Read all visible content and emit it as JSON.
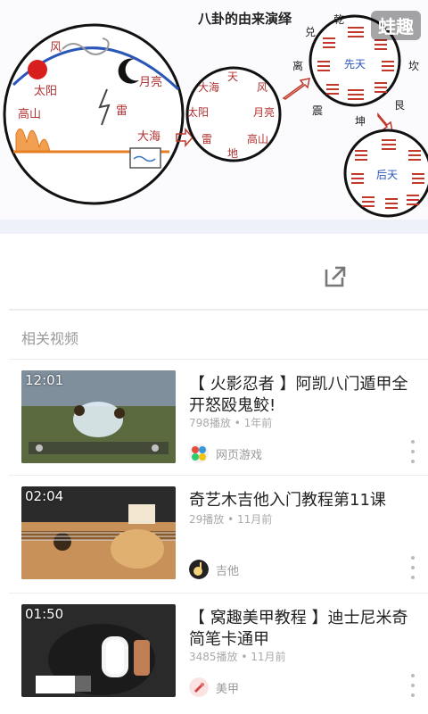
{
  "player": {
    "diagram_title": "八卦的由来演绎",
    "watermark": "蛙趣",
    "left_circle_labels": {
      "feng": "风",
      "taiyang": "太阳",
      "yueliang": "月亮",
      "lei": "雷",
      "gaoshan": "高山",
      "dahai": "大海"
    },
    "middle_circle_labels": {
      "tian": "天",
      "dahai": "大海",
      "feng": "风",
      "taiyang": "太阳",
      "yueliang": "月亮",
      "lei": "雷",
      "gaoshan": "高山",
      "di": "地"
    },
    "right_top_labels": {
      "dui": "兑",
      "qian": "乾",
      "li": "离",
      "xiantian": "先天",
      "kan": "坎",
      "zhen": "震",
      "kun": "坤",
      "gen": "艮"
    },
    "right_bottom_label": "后天"
  },
  "related": {
    "title": "相关视频",
    "items": [
      {
        "duration": "12:01",
        "title": "【 火影忍者 】阿凯八门遁甲全开怒殴鬼鲛!",
        "plays": "798播放",
        "time": "1年前",
        "category": "网页游戏",
        "theme": "game"
      },
      {
        "duration": "02:04",
        "title": "奇艺木吉他入门教程第11课",
        "plays": "29播放",
        "time": "11月前",
        "category": "吉他",
        "theme": "guitar"
      },
      {
        "duration": "01:50",
        "title": "【 窝趣美甲教程 】迪士尼米奇简笔卡通甲",
        "plays": "3485播放",
        "time": "11月前",
        "category": "美甲",
        "theme": "nail"
      }
    ]
  },
  "colors": {
    "accent_red": "#c0392b",
    "line_orange": "#e67e22",
    "divider": "#ececec",
    "meta_gray": "#aaaaaa"
  },
  "icons": {
    "share": "share-external-icon",
    "more": "more-vertical-icon"
  }
}
